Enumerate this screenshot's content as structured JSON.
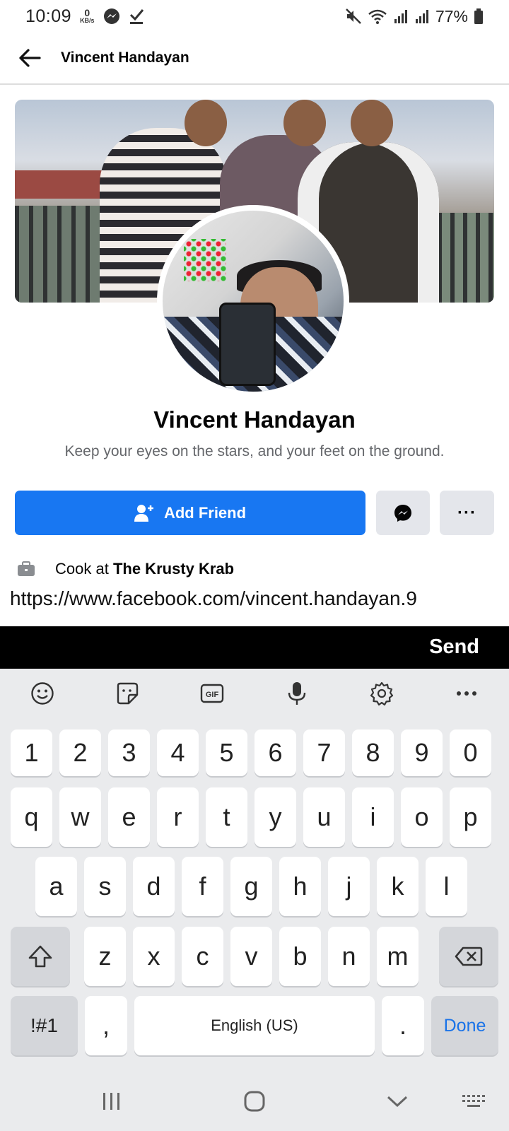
{
  "status_bar": {
    "time": "10:09",
    "speed_value": "0",
    "speed_unit": "KB/s",
    "battery": "77%"
  },
  "header": {
    "title": "Vincent Handayan"
  },
  "profile": {
    "name": "Vincent Handayan",
    "bio": "Keep your eyes on the stars, and your feet on the ground.",
    "add_friend_label": "Add Friend",
    "more_label": "···",
    "work_prefix": "Cook at",
    "work_place": "The Krusty Krab",
    "url": "https://www.facebook.com/vincent.handayan.9"
  },
  "send_bar": {
    "send_label": "Send"
  },
  "keyboard": {
    "toolbar": [
      "emoji-icon",
      "sticker-icon",
      "gif-icon",
      "mic-icon",
      "settings-icon",
      "more-icon"
    ],
    "gif_label": "GIF",
    "row_numbers": [
      "1",
      "2",
      "3",
      "4",
      "5",
      "6",
      "7",
      "8",
      "9",
      "0"
    ],
    "row_top": [
      "q",
      "w",
      "e",
      "r",
      "t",
      "y",
      "u",
      "i",
      "o",
      "p"
    ],
    "row_mid": [
      "a",
      "s",
      "d",
      "f",
      "g",
      "h",
      "j",
      "k",
      "l"
    ],
    "row_bottom": [
      "z",
      "x",
      "c",
      "v",
      "b",
      "n",
      "m"
    ],
    "symbols_label": "!#1",
    "comma_label": ",",
    "space_label": "English (US)",
    "period_label": ".",
    "done_label": "Done"
  },
  "colors": {
    "brand_blue": "#1877f2",
    "done_blue": "#1a73e8",
    "keyboard_bg": "#eaebed"
  }
}
